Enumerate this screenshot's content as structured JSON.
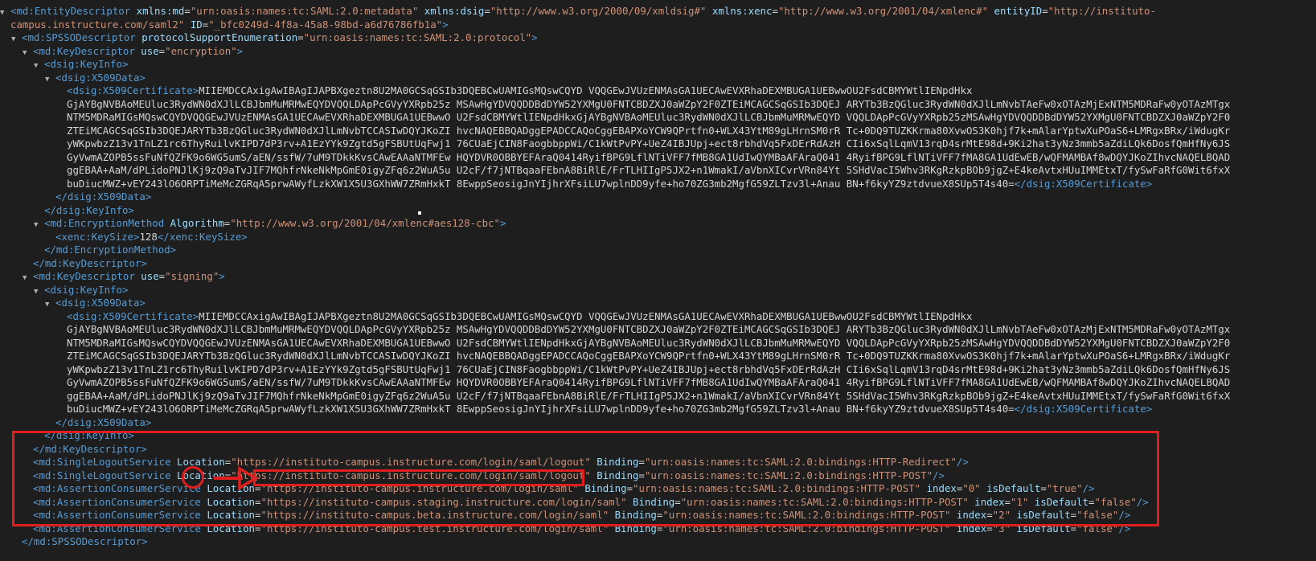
{
  "lines": [
    {
      "depth": 0,
      "toggle": "open",
      "segments": [
        [
          "tag",
          "<md:EntityDescriptor "
        ],
        [
          "attr",
          "xmlns:md"
        ],
        [
          "txt",
          "="
        ],
        [
          "val",
          "\"urn:oasis:names:tc:SAML:2.0:metadata\""
        ],
        [
          "txt",
          " "
        ],
        [
          "attr",
          "xmlns:dsig"
        ],
        [
          "txt",
          "="
        ],
        [
          "val",
          "\"http://www.w3.org/2000/09/xmldsig#\""
        ],
        [
          "txt",
          " "
        ],
        [
          "attr",
          "xmlns:xenc"
        ],
        [
          "txt",
          "="
        ],
        [
          "val",
          "\"http://www.w3.org/2001/04/xmlenc#\""
        ],
        [
          "txt",
          " "
        ],
        [
          "attr",
          "entityID"
        ],
        [
          "txt",
          "="
        ],
        [
          "val",
          "\"http://instituto-"
        ]
      ]
    },
    {
      "depth": 0,
      "toggle": "none",
      "segments": [
        [
          "val",
          "campus.instructure.com/saml2\""
        ],
        [
          "txt",
          " "
        ],
        [
          "attr",
          "ID"
        ],
        [
          "txt",
          "="
        ],
        [
          "val",
          "\"_bfc0249d-4f8a-45a8-98bd-a6d76786fb1a\""
        ],
        [
          "tag",
          ">"
        ]
      ]
    },
    {
      "depth": 1,
      "toggle": "open",
      "segments": [
        [
          "tag",
          "<md:SPSSODescriptor "
        ],
        [
          "attr",
          "protocolSupportEnumeration"
        ],
        [
          "txt",
          "="
        ],
        [
          "val",
          "\"urn:oasis:names:tc:SAML:2.0:protocol\""
        ],
        [
          "tag",
          ">"
        ]
      ]
    },
    {
      "depth": 2,
      "toggle": "open",
      "segments": [
        [
          "tag",
          "<md:KeyDescriptor "
        ],
        [
          "attr",
          "use"
        ],
        [
          "txt",
          "="
        ],
        [
          "val",
          "\"encryption\""
        ],
        [
          "tag",
          ">"
        ]
      ]
    },
    {
      "depth": 3,
      "toggle": "open",
      "segments": [
        [
          "tag",
          "<dsig:KeyInfo>"
        ]
      ]
    },
    {
      "depth": 4,
      "toggle": "open",
      "segments": [
        [
          "tag",
          "<dsig:X509Data>"
        ]
      ]
    },
    {
      "depth": 5,
      "toggle": "none",
      "segments": [
        [
          "tag",
          "<dsig:X509Certificate>"
        ],
        [
          "cert",
          "MIIEMDCCAxigAwIBAgIJAPBXgeztn8U2MA0GCSqGSIb3DQEBCwUAMIGsMQswCQYD VQQGEwJVUzENMAsGA1UECAwEVXRhaDEXMBUGA1UEBwwOU2FsdCBMYWtlIENpdHkx"
        ]
      ]
    },
    {
      "depth": 5,
      "toggle": "none",
      "segments": [
        [
          "cert",
          "GjAYBgNVBAoMEUluc3RydWN0dXJlLCBJbmMuMRMwEQYDVQQLDApPcGVyYXRpb25z MSAwHgYDVQQDDBdDYW52YXMgU0FNTCBDZXJ0aWZpY2F0ZTEiMCAGCSqGSIb3DQEJ ARYTb3BzQGluc3RydWN0dXJlLmNvbTAeFw0xOTAzMjExNTM5MDRaFw0yOTAzMTgx"
        ]
      ]
    },
    {
      "depth": 5,
      "toggle": "none",
      "segments": [
        [
          "cert",
          "NTM5MDRaMIGsMQswCQYDVQQGEwJVUzENMAsGA1UECAwEVXRhaDEXMBUGA1UEBwwO U2FsdCBMYWtlIENpdHkxGjAYBgNVBAoMEUluc3RydWN0dXJlLCBJbmMuMRMwEQYD VQQLDApPcGVyYXRpb25zMSAwHgYDVQQDDBdDYW52YXMgU0FNTCBDZXJ0aWZpY2F0"
        ]
      ]
    },
    {
      "depth": 5,
      "toggle": "none",
      "segments": [
        [
          "cert",
          "ZTEiMCAGCSqGSIb3DQEJARYTb3BzQGluc3RydWN0dXJlLmNvbTCCASIwDQYJKoZI hvcNAQEBBQADggEPADCCAQoCggEBAPXoYCW9QPrtfn0+WLX43YtM89gLHrnSM0rR Tc+0DQ9TUZKKrma80XvwOS3K0hjf7k+mAlarYptwXuPOaS6+LMRgxBRx/iWdugKr"
        ]
      ]
    },
    {
      "depth": 5,
      "toggle": "none",
      "segments": [
        [
          "cert",
          "yWKpwbzZ13v1TnLZ1rc6ThyRuilvKIPD7dP3rv+A1EzYYk9Zgtd5gFSBUtUqFwj1 76CUaEjCIN8FaogbbppWi/C1kWtPvPY+UeZ4IBJUpj+ect8rbhdVq5FxDErRdAzH CIi6xSqlLqmV13rqD4srMtE98d+9Ki2hat3yNz3mmb5aZdiLQk6DosfQmHfNy6JS"
        ]
      ]
    },
    {
      "depth": 5,
      "toggle": "none",
      "segments": [
        [
          "cert",
          "GyVwmAZOPB5ssFuNfQZFK9o6WG5umS/aEN/ssfW/7uM9TDkkKvsCAwEAAaNTMFEw HQYDVR0OBBYEFAraQ0414RyifBPG9LflNTiVFF7fMB8GA1UdIwQYMBaAFAraQ041 4RyifBPG9LflNTiVFF7fMA8GA1UdEwEB/wQFMAMBAf8wDQYJKoZIhvcNAQELBQAD"
        ]
      ]
    },
    {
      "depth": 5,
      "toggle": "none",
      "segments": [
        [
          "cert",
          "ggEBAA+AaM/dPLidoPNJlKj9zQ9aTvJIF7MQhfrNkeNkMpGmE0igyZFq6z2WuA5u U2cF/f7jNTBqaaFEbnA8BiRlE/FrTLHIIgP5JX2+n1WmakI/aVbnXICvrVRn84Yt 5SHdVacI5Whv3RKgRzkpBOb9jgZ+E4keAvtxHUuIMMEtxT/fySwFaRfG0Wit6fxX"
        ]
      ]
    },
    {
      "depth": 5,
      "toggle": "none",
      "segments": [
        [
          "cert",
          "buDiucMWZ+vEY243lO6ORPTiMeMcZGRqA5prwAWyfLzkXW1X5U3GXhWW7ZRmHxkT 8EwppSeosigJnYIjhrXFsiLU7wplnDD9yfe+ho70ZG3mb2MgfG59ZLTzv3l+Anau BN+f6kyYZ9ztdvueX8SUp5T4s40="
        ],
        [
          "tag",
          "</dsig:X509Certificate>"
        ]
      ]
    },
    {
      "depth": 4,
      "toggle": "none",
      "segments": [
        [
          "tag",
          "</dsig:X509Data>"
        ]
      ]
    },
    {
      "depth": 3,
      "toggle": "none",
      "segments": [
        [
          "tag",
          "</dsig:KeyInfo>"
        ]
      ]
    },
    {
      "depth": 3,
      "toggle": "open",
      "segments": [
        [
          "tag",
          "<md:EncryptionMethod "
        ],
        [
          "attr",
          "Algorithm"
        ],
        [
          "txt",
          "="
        ],
        [
          "val",
          "\"http://www.w3.org/2001/04/xmlenc#aes128-cbc\""
        ],
        [
          "tag",
          ">"
        ]
      ]
    },
    {
      "depth": 4,
      "toggle": "none",
      "segments": [
        [
          "tag",
          "<xenc:KeySize>"
        ],
        [
          "txt",
          "128"
        ],
        [
          "tag",
          "</xenc:KeySize>"
        ]
      ]
    },
    {
      "depth": 3,
      "toggle": "none",
      "segments": [
        [
          "tag",
          "</md:EncryptionMethod>"
        ]
      ]
    },
    {
      "depth": 2,
      "toggle": "none",
      "segments": [
        [
          "tag",
          "</md:KeyDescriptor>"
        ]
      ]
    },
    {
      "depth": 2,
      "toggle": "open",
      "segments": [
        [
          "tag",
          "<md:KeyDescriptor "
        ],
        [
          "attr",
          "use"
        ],
        [
          "txt",
          "="
        ],
        [
          "val",
          "\"signing\""
        ],
        [
          "tag",
          ">"
        ]
      ]
    },
    {
      "depth": 3,
      "toggle": "open",
      "segments": [
        [
          "tag",
          "<dsig:KeyInfo>"
        ]
      ]
    },
    {
      "depth": 4,
      "toggle": "open",
      "segments": [
        [
          "tag",
          "<dsig:X509Data>"
        ]
      ]
    },
    {
      "depth": 5,
      "toggle": "none",
      "segments": [
        [
          "tag",
          "<dsig:X509Certificate>"
        ],
        [
          "cert",
          "MIIEMDCCAxigAwIBAgIJAPBXgeztn8U2MA0GCSqGSIb3DQEBCwUAMIGsMQswCQYD VQQGEwJVUzENMAsGA1UECAwEVXRhaDEXMBUGA1UEBwwOU2FsdCBMYWtlIENpdHkx"
        ]
      ]
    },
    {
      "depth": 5,
      "toggle": "none",
      "segments": [
        [
          "cert",
          "GjAYBgNVBAoMEUluc3RydWN0dXJlLCBJbmMuMRMwEQYDVQQLDApPcGVyYXRpb25z MSAwHgYDVQQDDBdDYW52YXMgU0FNTCBDZXJ0aWZpY2F0ZTEiMCAGCSqGSIb3DQEJ ARYTb3BzQGluc3RydWN0dXJlLmNvbTAeFw0xOTAzMjExNTM5MDRaFw0yOTAzMTgx"
        ]
      ]
    },
    {
      "depth": 5,
      "toggle": "none",
      "segments": [
        [
          "cert",
          "NTM5MDRaMIGsMQswCQYDVQQGEwJVUzENMAsGA1UECAwEVXRhaDEXMBUGA1UEBwwO U2FsdCBMYWtlIENpdHkxGjAYBgNVBAoMEUluc3RydWN0dXJlLCBJbmMuMRMwEQYD VQQLDApPcGVyYXRpb25zMSAwHgYDVQQDDBdDYW52YXMgU0FNTCBDZXJ0aWZpY2F0"
        ]
      ]
    },
    {
      "depth": 5,
      "toggle": "none",
      "segments": [
        [
          "cert",
          "ZTEiMCAGCSqGSIb3DQEJARYTb3BzQGluc3RydWN0dXJlLmNvbTCCASIwDQYJKoZI hvcNAQEBBQADggEPADCCAQoCggEBAPXoYCW9QPrtfn0+WLX43YtM89gLHrnSM0rR Tc+0DQ9TUZKKrma80XvwOS3K0hjf7k+mAlarYptwXuPOaS6+LMRgxBRx/iWdugKr"
        ]
      ]
    },
    {
      "depth": 5,
      "toggle": "none",
      "segments": [
        [
          "cert",
          "yWKpwbzZ13v1TnLZ1rc6ThyRuilvKIPD7dP3rv+A1EzYYk9Zgtd5gFSBUtUqFwj1 76CUaEjCIN8FaogbbppWi/C1kWtPvPY+UeZ4IBJUpj+ect8rbhdVq5FxDErRdAzH CIi6xSqlLqmV13rqD4srMtE98d+9Ki2hat3yNz3mmb5aZdiLQk6DosfQmHfNy6JS"
        ]
      ]
    },
    {
      "depth": 5,
      "toggle": "none",
      "segments": [
        [
          "cert",
          "GyVwmAZOPB5ssFuNfQZFK9o6WG5umS/aEN/ssfW/7uM9TDkkKvsCAwEAAaNTMFEw HQYDVR0OBBYEFAraQ0414RyifBPG9LflNTiVFF7fMB8GA1UdIwQYMBaAFAraQ041 4RyifBPG9LflNTiVFF7fMA8GA1UdEwEB/wQFMAMBAf8wDQYJKoZIhvcNAQELBQAD"
        ]
      ]
    },
    {
      "depth": 5,
      "toggle": "none",
      "segments": [
        [
          "cert",
          "ggEBAA+AaM/dPLidoPNJlKj9zQ9aTvJIF7MQhfrNkeNkMpGmE0igyZFq6z2WuA5u U2cF/f7jNTBqaaFEbnA8BiRlE/FrTLHIIgP5JX2+n1WmakI/aVbnXICvrVRn84Yt 5SHdVacI5Whv3RKgRzkpBOb9jgZ+E4keAvtxHUuIMMEtxT/fySwFaRfG0Wit6fxX"
        ]
      ]
    },
    {
      "depth": 5,
      "toggle": "none",
      "segments": [
        [
          "cert",
          "buDiucMWZ+vEY243lO6ORPTiMeMcZGRqA5prwAWyfLzkXW1X5U3GXhWW7ZRmHxkT 8EwppSeosigJnYIjhrXFsiLU7wplnDD9yfe+ho70ZG3mb2MgfG59ZLTzv3l+Anau BN+f6kyYZ9ztdvueX8SUp5T4s40="
        ],
        [
          "tag",
          "</dsig:X509Certificate>"
        ]
      ]
    },
    {
      "depth": 4,
      "toggle": "none",
      "segments": [
        [
          "tag",
          "</dsig:X509Data>"
        ]
      ]
    },
    {
      "depth": 3,
      "toggle": "none",
      "segments": [
        [
          "tag",
          "</dsig:KeyInfo>"
        ]
      ]
    },
    {
      "depth": 2,
      "toggle": "none",
      "segments": [
        [
          "tag",
          "</md:KeyDescriptor>"
        ]
      ]
    },
    {
      "depth": 2,
      "toggle": "none",
      "segments": [
        [
          "tag",
          "<md:SingleLogoutService "
        ],
        [
          "attr",
          "Location"
        ],
        [
          "txt",
          "="
        ],
        [
          "val",
          "\"https://instituto-campus.instructure.com/login/saml/logout\""
        ],
        [
          "txt",
          " "
        ],
        [
          "attr",
          "Binding"
        ],
        [
          "txt",
          "="
        ],
        [
          "val",
          "\"urn:oasis:names:tc:SAML:2.0:bindings:HTTP-Redirect\""
        ],
        [
          "tag",
          "/>"
        ]
      ]
    },
    {
      "depth": 2,
      "toggle": "none",
      "segments": [
        [
          "tag",
          "<md:SingleLogoutService "
        ],
        [
          "attr",
          "Location"
        ],
        [
          "txt",
          "="
        ],
        [
          "val",
          "\"https://instituto-campus.instructure.com/login/saml/logout\""
        ],
        [
          "txt",
          " "
        ],
        [
          "attr",
          "Binding"
        ],
        [
          "txt",
          "="
        ],
        [
          "val",
          "\"urn:oasis:names:tc:SAML:2.0:bindings:HTTP-POST\""
        ],
        [
          "tag",
          "/>"
        ]
      ]
    },
    {
      "depth": 2,
      "toggle": "none",
      "segments": [
        [
          "tag",
          "<md:AssertionConsumerService "
        ],
        [
          "attr",
          "Location"
        ],
        [
          "txt",
          "="
        ],
        [
          "val",
          "\"https://instituto-campus.instructure.com/login/saml\""
        ],
        [
          "txt",
          " "
        ],
        [
          "attr",
          "Binding"
        ],
        [
          "txt",
          "="
        ],
        [
          "val",
          "\"urn:oasis:names:tc:SAML:2.0:bindings:HTTP-POST\""
        ],
        [
          "txt",
          " "
        ],
        [
          "attr",
          "index"
        ],
        [
          "txt",
          "="
        ],
        [
          "val",
          "\"0\""
        ],
        [
          "txt",
          " "
        ],
        [
          "attr",
          "isDefault"
        ],
        [
          "txt",
          "="
        ],
        [
          "val",
          "\"true\""
        ],
        [
          "tag",
          "/>"
        ]
      ]
    },
    {
      "depth": 2,
      "toggle": "none",
      "segments": [
        [
          "tag",
          "<md:AssertionConsumerService "
        ],
        [
          "attr",
          "Location"
        ],
        [
          "txt",
          "="
        ],
        [
          "val",
          "\"https://instituto-campus.staging.instructure.com/login/saml\""
        ],
        [
          "txt",
          " "
        ],
        [
          "attr",
          "Binding"
        ],
        [
          "txt",
          "="
        ],
        [
          "val",
          "\"urn:oasis:names:tc:SAML:2.0:bindings:HTTP-POST\""
        ],
        [
          "txt",
          " "
        ],
        [
          "attr",
          "index"
        ],
        [
          "txt",
          "="
        ],
        [
          "val",
          "\"1\""
        ],
        [
          "txt",
          " "
        ],
        [
          "attr",
          "isDefault"
        ],
        [
          "txt",
          "="
        ],
        [
          "val",
          "\"false\""
        ],
        [
          "tag",
          "/>"
        ]
      ]
    },
    {
      "depth": 2,
      "toggle": "none",
      "segments": [
        [
          "tag",
          "<md:AssertionConsumerService "
        ],
        [
          "attr",
          "Location"
        ],
        [
          "txt",
          "="
        ],
        [
          "val",
          "\"https://instituto-campus.beta.instructure.com/login/saml\""
        ],
        [
          "txt",
          " "
        ],
        [
          "attr",
          "Binding"
        ],
        [
          "txt",
          "="
        ],
        [
          "val",
          "\"urn:oasis:names:tc:SAML:2.0:bindings:HTTP-POST\""
        ],
        [
          "txt",
          " "
        ],
        [
          "attr",
          "index"
        ],
        [
          "txt",
          "="
        ],
        [
          "val",
          "\"2\""
        ],
        [
          "txt",
          " "
        ],
        [
          "attr",
          "isDefault"
        ],
        [
          "txt",
          "="
        ],
        [
          "val",
          "\"false\""
        ],
        [
          "tag",
          "/>"
        ]
      ]
    },
    {
      "depth": 2,
      "toggle": "none",
      "segments": [
        [
          "tag",
          "<md:AssertionConsumerService "
        ],
        [
          "attr",
          "Location"
        ],
        [
          "txt",
          "="
        ],
        [
          "val",
          "\"https://instituto-campus.test.instructure.com/login/saml\""
        ],
        [
          "txt",
          " "
        ],
        [
          "attr",
          "Binding"
        ],
        [
          "txt",
          "="
        ],
        [
          "val",
          "\"urn:oasis:names:tc:SAML:2.0:bindings:HTTP-POST\""
        ],
        [
          "txt",
          " "
        ],
        [
          "attr",
          "index"
        ],
        [
          "txt",
          "="
        ],
        [
          "val",
          "\"3\""
        ],
        [
          "txt",
          " "
        ],
        [
          "attr",
          "isDefault"
        ],
        [
          "txt",
          "="
        ],
        [
          "val",
          "\"false\""
        ],
        [
          "tag",
          "/>"
        ]
      ]
    },
    {
      "depth": 1,
      "toggle": "none",
      "segments": [
        [
          "tag",
          "</md:SPSSODescriptor>"
        ]
      ]
    }
  ],
  "icons": {
    "expanded": "triangle-down-icon"
  },
  "colors": {
    "background": "#1e1e1e",
    "tag": "#569cd6",
    "attribute": "#9cdcfe",
    "value": "#ce9178",
    "text": "#d4d4d4",
    "annotation": "#e01e1e"
  }
}
